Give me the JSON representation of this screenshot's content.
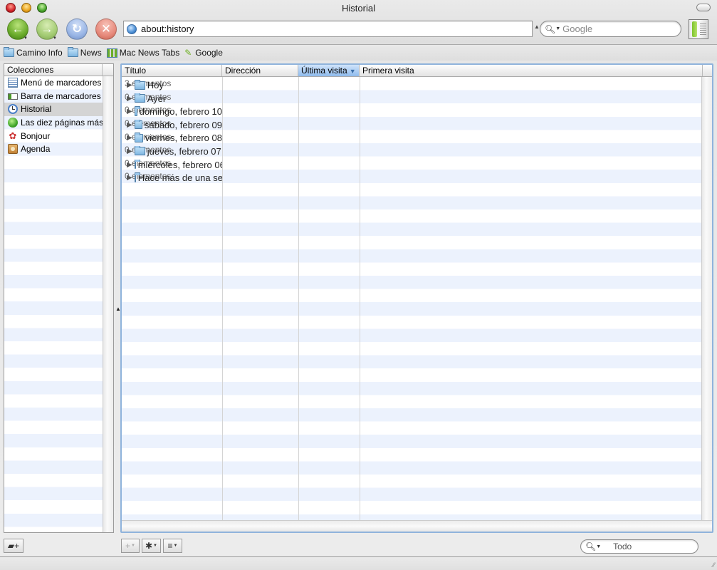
{
  "window": {
    "title": "Historial"
  },
  "toolbar": {
    "back_icon": "←",
    "forward_icon": "→",
    "reload_icon": "↻",
    "stop_icon": "✕",
    "url": "about:history",
    "search_placeholder": "Google"
  },
  "bookmarks_bar": [
    {
      "label": "Camino Info",
      "icon": "folder-icon"
    },
    {
      "label": "News",
      "icon": "folder-icon"
    },
    {
      "label": "Mac News Tabs",
      "icon": "tab-group-icon"
    },
    {
      "label": "Google",
      "icon": "bookmark-leaf-icon"
    }
  ],
  "collections": {
    "header": "Colecciones",
    "items": [
      {
        "label": "Menú de marcadores",
        "icon": "bookmark-menu-icon"
      },
      {
        "label": "Barra de marcadores",
        "icon": "bookmark-bar-icon"
      },
      {
        "label": "Historial",
        "icon": "history-clock-icon",
        "selected": true
      },
      {
        "label": "Las diez páginas más visitadas",
        "icon": "top-ten-icon"
      },
      {
        "label": "Bonjour",
        "icon": "bonjour-icon"
      },
      {
        "label": "Agenda",
        "icon": "address-book-icon"
      }
    ]
  },
  "history_table": {
    "columns": [
      {
        "label": "Título"
      },
      {
        "label": "Dirección"
      },
      {
        "label": "Última visita",
        "sorted": true,
        "sort_arrow": "▼"
      },
      {
        "label": "Primera visita"
      }
    ],
    "rows": [
      {
        "title": "Hoy",
        "address": "3 elementos"
      },
      {
        "title": "Ayer",
        "address": "0 elementos"
      },
      {
        "title": "domingo, febrero 10",
        "address": "0 elementos"
      },
      {
        "title": "sábado, febrero 09",
        "address": "0 elementos"
      },
      {
        "title": "viernes, febrero 08",
        "address": "0 elementos"
      },
      {
        "title": "jueves, febrero 07",
        "address": "0 elementos"
      },
      {
        "title": "miércoles, febrero 06",
        "address": "0 elementos"
      },
      {
        "title": "Hace más de una semana",
        "address": "0 elementos"
      }
    ]
  },
  "bottom_bar": {
    "new_folder_icon": "▰+",
    "add_icon": "+",
    "action_icon": "✱",
    "view_icon": "≡",
    "filter_placeholder": "Todo"
  }
}
